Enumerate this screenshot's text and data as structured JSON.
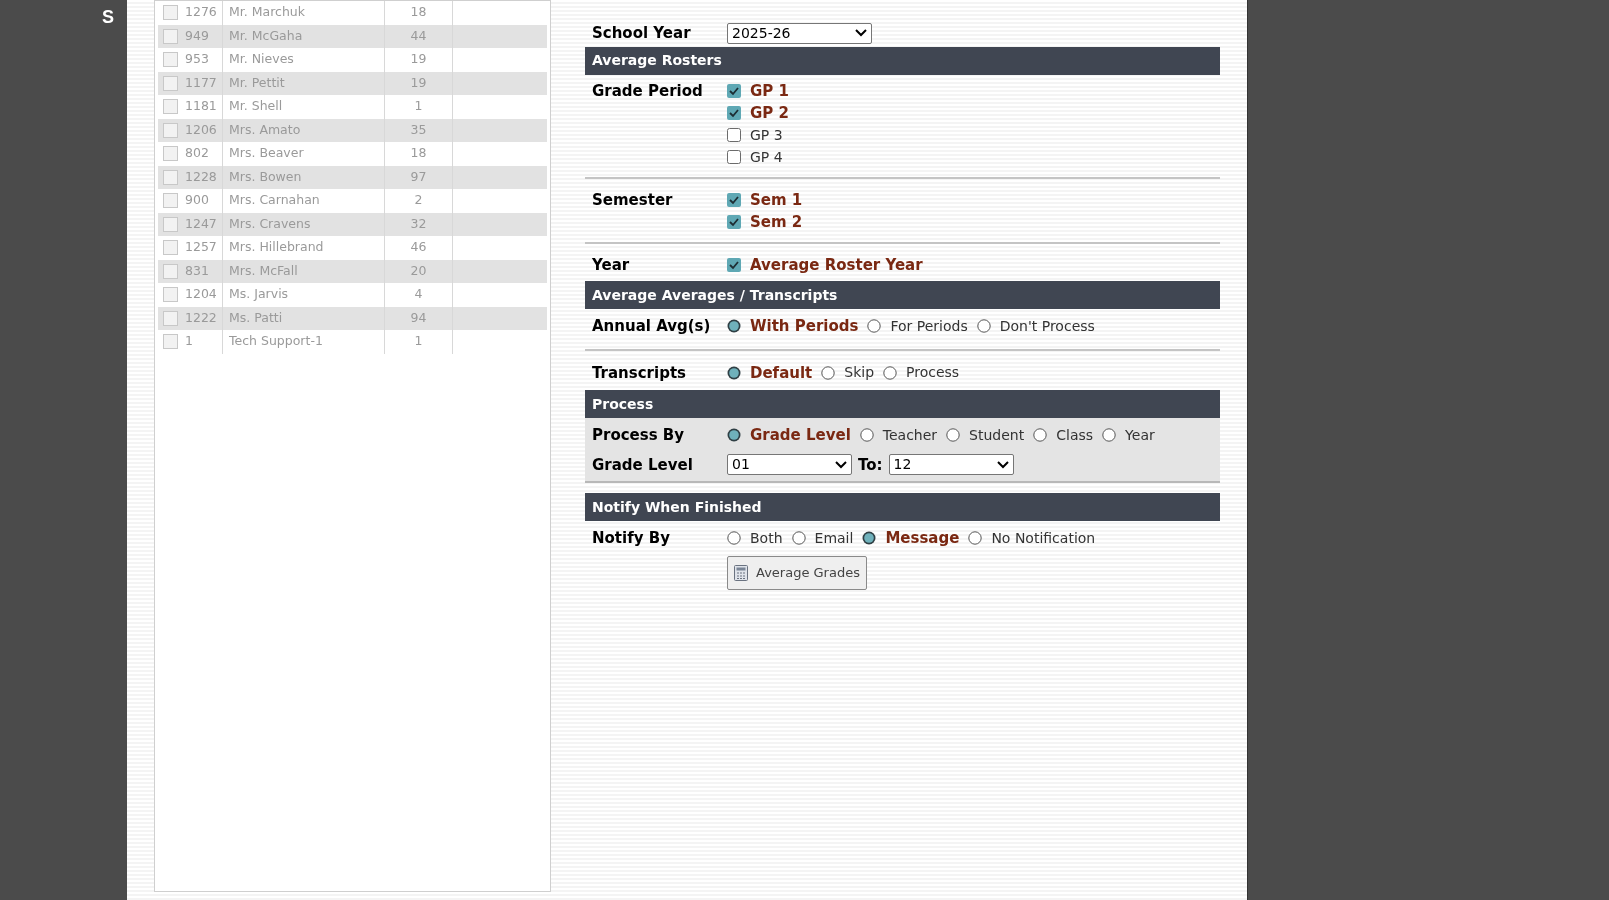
{
  "sidebar_letter": "S",
  "teachers_table": {
    "rows": [
      {
        "checked": false,
        "id": "1276",
        "name": "Mr. Marchuk",
        "count": "18"
      },
      {
        "checked": false,
        "id": "949",
        "name": "Mr. McGaha",
        "count": "44"
      },
      {
        "checked": false,
        "id": "953",
        "name": "Mr. Nieves",
        "count": "19"
      },
      {
        "checked": false,
        "id": "1177",
        "name": "Mr. Pettit",
        "count": "19"
      },
      {
        "checked": false,
        "id": "1181",
        "name": "Mr. Shell",
        "count": "1"
      },
      {
        "checked": false,
        "id": "1206",
        "name": "Mrs. Amato",
        "count": "35"
      },
      {
        "checked": false,
        "id": "802",
        "name": "Mrs. Beaver",
        "count": "18"
      },
      {
        "checked": false,
        "id": "1228",
        "name": "Mrs. Bowen",
        "count": "97"
      },
      {
        "checked": false,
        "id": "900",
        "name": "Mrs. Carnahan",
        "count": "2"
      },
      {
        "checked": false,
        "id": "1247",
        "name": "Mrs. Cravens",
        "count": "32"
      },
      {
        "checked": false,
        "id": "1257",
        "name": "Mrs. Hillebrand",
        "count": "46"
      },
      {
        "checked": false,
        "id": "831",
        "name": "Mrs. McFall",
        "count": "20"
      },
      {
        "checked": false,
        "id": "1204",
        "name": "Ms. Jarvis",
        "count": "4"
      },
      {
        "checked": false,
        "id": "1222",
        "name": "Ms. Patti",
        "count": "94"
      },
      {
        "checked": false,
        "id": "1",
        "name": "Tech Support-1",
        "count": "1"
      }
    ]
  },
  "form": {
    "school_year": {
      "label": "School Year",
      "value": "2025-26"
    },
    "sections": [
      {
        "title": "Average Rosters",
        "shaded": false,
        "groups": [
          {
            "kind": "checkbox_list",
            "label": "Grade Period",
            "options": [
              {
                "label": "GP 1",
                "checked": true
              },
              {
                "label": "GP 2",
                "checked": true
              },
              {
                "label": "GP 3",
                "checked": false
              },
              {
                "label": "GP 4",
                "checked": false
              }
            ]
          },
          {
            "kind": "checkbox_list",
            "label": "Semester",
            "options": [
              {
                "label": "Sem 1",
                "checked": true
              },
              {
                "label": "Sem 2",
                "checked": true
              }
            ]
          },
          {
            "kind": "checkbox_list",
            "label": "Year",
            "options": [
              {
                "label": "Average Roster Year",
                "checked": true
              }
            ]
          }
        ]
      },
      {
        "title": "Average Averages / Transcripts",
        "shaded": false,
        "groups": [
          {
            "kind": "radio_row",
            "label": "Annual Avg(s)",
            "options": [
              {
                "label": "With Periods",
                "selected": true
              },
              {
                "label": "For Periods",
                "selected": false
              },
              {
                "label": "Don't Process",
                "selected": false
              }
            ]
          },
          {
            "kind": "radio_row",
            "label": "Transcripts",
            "options": [
              {
                "label": "Default",
                "selected": true
              },
              {
                "label": "Skip",
                "selected": false
              },
              {
                "label": "Process",
                "selected": false
              }
            ]
          }
        ]
      },
      {
        "title": "Process",
        "shaded": true,
        "groups": [
          {
            "kind": "radio_row",
            "label": "Process By",
            "options": [
              {
                "label": "Grade Level",
                "selected": true
              },
              {
                "label": "Teacher",
                "selected": false
              },
              {
                "label": "Student",
                "selected": false
              },
              {
                "label": "Class",
                "selected": false
              },
              {
                "label": "Year",
                "selected": false
              }
            ]
          },
          {
            "kind": "range",
            "label": "Grade Level",
            "from": "01",
            "to_label": "To:",
            "to": "12"
          }
        ]
      },
      {
        "title": "Notify When Finished",
        "shaded": false,
        "groups": [
          {
            "kind": "radio_row",
            "label": "Notify By",
            "options": [
              {
                "label": "Both",
                "selected": false
              },
              {
                "label": "Email",
                "selected": false
              },
              {
                "label": "Message",
                "selected": true
              },
              {
                "label": "No Notification",
                "selected": false
              }
            ]
          },
          {
            "kind": "button",
            "label": "Average Grades"
          }
        ]
      }
    ]
  }
}
